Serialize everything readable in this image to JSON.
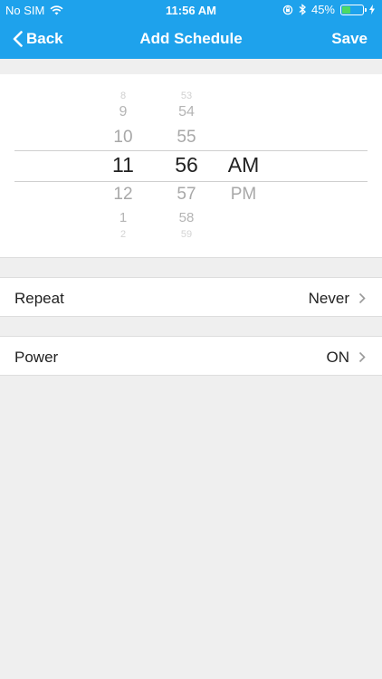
{
  "status_bar": {
    "carrier": "No SIM",
    "time": "11:56 AM",
    "battery": "45%",
    "battery_level": 0.45
  },
  "nav": {
    "back_label": "Back",
    "title": "Add Schedule",
    "save_label": "Save"
  },
  "picker": {
    "hours": [
      "8",
      "9",
      "10",
      "11",
      "12",
      "1",
      "2"
    ],
    "minutes": [
      "53",
      "54",
      "55",
      "56",
      "57",
      "58",
      "59"
    ],
    "periods": [
      "AM",
      "PM"
    ],
    "selected": {
      "hour": "11",
      "minute": "56",
      "period": "AM"
    }
  },
  "settings": {
    "repeat": {
      "label": "Repeat",
      "value": "Never"
    },
    "power": {
      "label": "Power",
      "value": "ON"
    }
  },
  "colors": {
    "accent": "#1ea2ec",
    "battery": "#4cd964"
  }
}
